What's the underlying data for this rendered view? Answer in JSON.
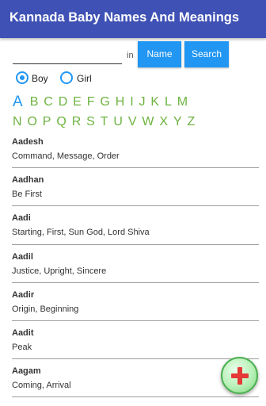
{
  "appbar": {
    "title": "Kannada Baby Names And Meanings"
  },
  "search": {
    "input_value": "",
    "in_label": "in",
    "name_button": "Name",
    "search_button": "Search"
  },
  "gender": {
    "boy_label": "Boy",
    "girl_label": "Girl",
    "selected": "Boy"
  },
  "alphabet": {
    "selected": "A",
    "row1": [
      "A",
      "B",
      "C",
      "D",
      "E",
      "F",
      "G",
      "H",
      "I",
      "J",
      "K",
      "L",
      "M"
    ],
    "row2": [
      "N",
      "O",
      "P",
      "Q",
      "R",
      "S",
      "T",
      "U",
      "V",
      "W",
      "X",
      "Y",
      "Z"
    ]
  },
  "names": [
    {
      "name": "Aadesh",
      "meaning": "Command, Message, Order"
    },
    {
      "name": "Aadhan",
      "meaning": "Be First"
    },
    {
      "name": "Aadi",
      "meaning": "Starting, First, Sun God, Lord Shiva"
    },
    {
      "name": "Aadil",
      "meaning": "Justice, Upright, Sincere"
    },
    {
      "name": "Aadir",
      "meaning": "Origin, Beginning"
    },
    {
      "name": "Aadit",
      "meaning": "Peak"
    },
    {
      "name": "Aagam",
      "meaning": "Coming, Arrival"
    }
  ],
  "fab": {
    "icon": "plus-icon"
  },
  "colors": {
    "appbar": "#3f51b5",
    "button": "#2196f3",
    "letter": "#6db33f",
    "fab_plus": "#e53935"
  }
}
